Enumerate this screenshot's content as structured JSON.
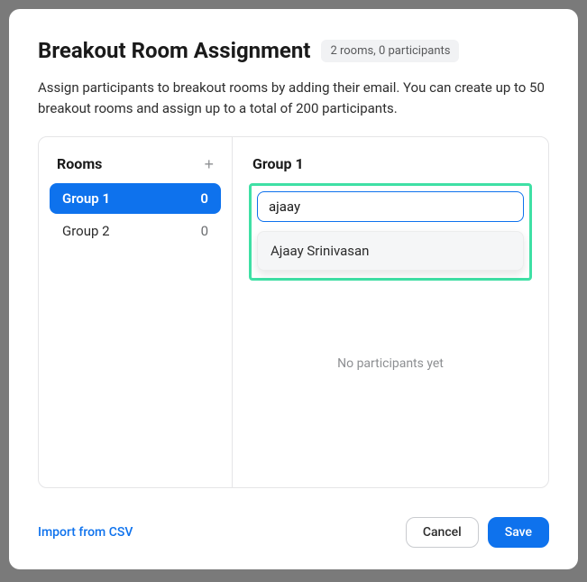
{
  "header": {
    "title": "Breakout Room Assignment",
    "summary": "2 rooms, 0 participants"
  },
  "description": "Assign participants to breakout rooms by adding their email. You can create up to 50 breakout rooms and assign up to a total of 200 participants.",
  "rooms_panel": {
    "title": "Rooms",
    "add_icon": "+",
    "items": [
      {
        "name": "Group 1",
        "count": "0",
        "active": true
      },
      {
        "name": "Group 2",
        "count": "0",
        "active": false
      }
    ]
  },
  "detail_panel": {
    "title": "Group 1",
    "search_value": "ajaay",
    "suggestions": [
      "Ajaay Srinivasan"
    ],
    "empty_text": "No participants yet"
  },
  "footer": {
    "import_label": "Import from CSV",
    "cancel_label": "Cancel",
    "save_label": "Save"
  }
}
